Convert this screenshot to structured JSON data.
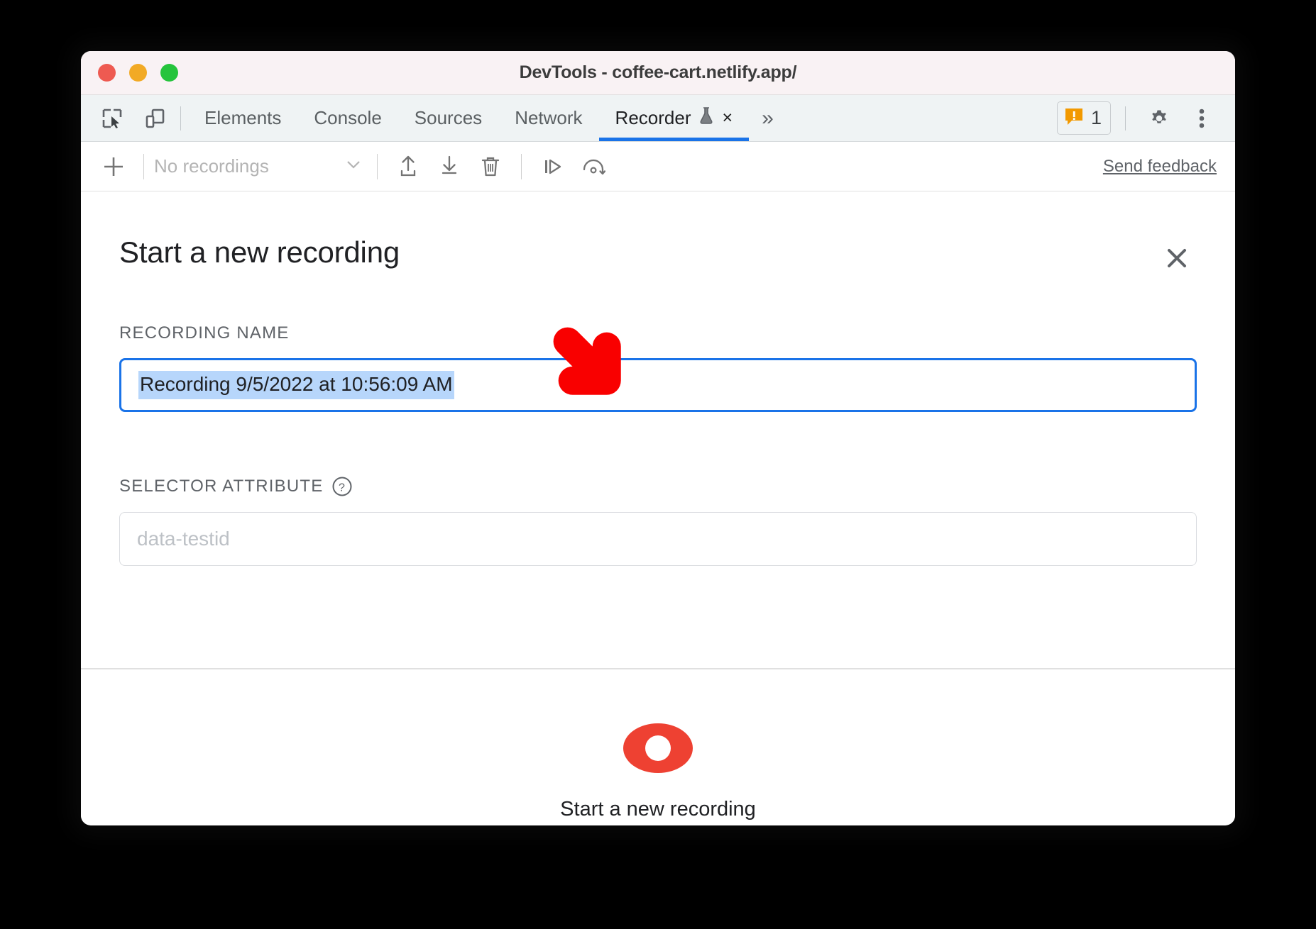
{
  "window": {
    "title": "DevTools - coffee-cart.netlify.app/",
    "traffic_lights": [
      "close",
      "minimize",
      "maximize"
    ]
  },
  "tabbar": {
    "left_icons": [
      {
        "name": "inspect-element-icon",
        "label": "Inspect element"
      },
      {
        "name": "device-toolbar-icon",
        "label": "Toggle device toolbar"
      }
    ],
    "tabs": [
      {
        "label": "Elements",
        "active": false
      },
      {
        "label": "Console",
        "active": false
      },
      {
        "label": "Sources",
        "active": false
      },
      {
        "label": "Network",
        "active": false
      },
      {
        "label": "Recorder",
        "active": true,
        "experiment": true,
        "closable": true
      }
    ],
    "tab_close_glyph": "×",
    "more_tabs_glyph": "»",
    "warnings_count": "1",
    "right_icons": [
      {
        "name": "settings-gear-icon",
        "label": "Settings"
      },
      {
        "name": "more-options-icon",
        "label": "Customize and control DevTools"
      }
    ]
  },
  "toolbar": {
    "add_label": "Add recording",
    "recordings_select_value": "No recordings",
    "actions": [
      {
        "name": "import-recording-icon",
        "label": "Import recording"
      },
      {
        "name": "export-recording-icon",
        "label": "Export recording"
      },
      {
        "name": "delete-recording-icon",
        "label": "Delete recording"
      },
      {
        "name": "step-replay-icon",
        "label": "Replay step by step"
      },
      {
        "name": "measure-performance-icon",
        "label": "Measure performance"
      }
    ],
    "send_feedback": "Send feedback"
  },
  "panel": {
    "title": "Start a new recording",
    "close_glyph": "×",
    "recording_name": {
      "label": "RECORDING NAME",
      "value": "Recording 9/5/2022 at 10:56:09 AM",
      "selected": true
    },
    "selector_attribute": {
      "label": "SELECTOR ATTRIBUTE",
      "help_glyph": "?",
      "placeholder": "data-testid",
      "value": ""
    },
    "footer": {
      "record_button_label": "Start a new recording"
    }
  },
  "annotation": {
    "arrow": {
      "color": "#f90000",
      "direction": "down-left",
      "points_at": "recording-name-input"
    }
  },
  "colors": {
    "accent_blue": "#1a73e8",
    "selection_blue": "#b7d6fb",
    "record_red": "#ee4132",
    "warning_orange": "#f29900",
    "arrow_red": "#f90000",
    "titlebar_bg": "#f9f2f4",
    "tabbar_bg": "#eff3f4"
  }
}
